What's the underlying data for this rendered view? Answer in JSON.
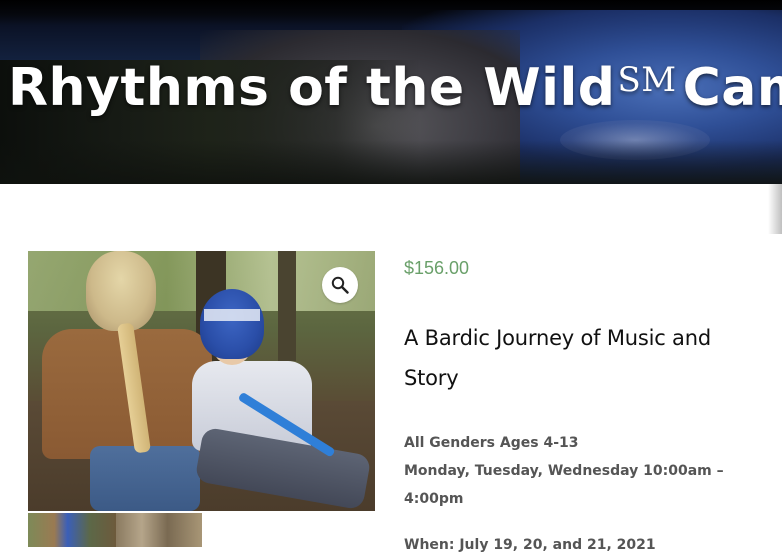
{
  "hero": {
    "title_main": "Rhythms of the Wild",
    "title_mark": "SM",
    "title_end": "Camp"
  },
  "product": {
    "price": "$156.00",
    "title": "A Bardic Journey of Music and Story",
    "audience": "All Genders Ages 4-13",
    "schedule": "Monday, Tuesday, Wednesday 10:00am – 4:00pm",
    "when_partial": "When: July 19, 20, and 21, 2021"
  },
  "gallery": {
    "zoom_icon": "magnifier-icon",
    "thumbnail_count": 2
  },
  "colors": {
    "price": "#6aa06a",
    "title": "#111111",
    "body_text": "#555555",
    "background": "#ffffff"
  }
}
